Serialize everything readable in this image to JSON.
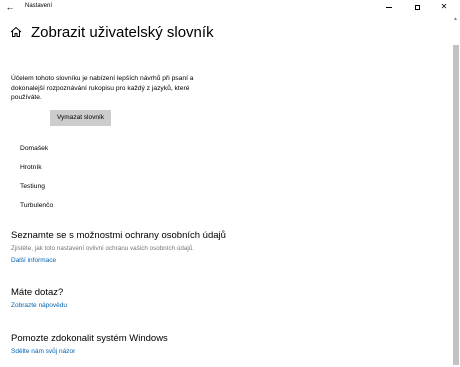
{
  "window": {
    "title": "Nastavení",
    "back_icon": "back-arrow-icon",
    "minimize_icon": "minimize-icon",
    "maximize_icon": "maximize-icon",
    "close_icon": "close-icon"
  },
  "header": {
    "home_icon": "home-icon",
    "title": "Zobrazit uživatelský slovník"
  },
  "dictionary": {
    "description": "Účelem tohoto slovníku je nabízení lepších návrhů při psaní a dokonalejší rozpoznávání rukopisu pro každý z jazyků, které používáte.",
    "clear_button": "Vymazat slovník",
    "words": [
      "Domašek",
      "Hrotník",
      "Testiung",
      "Turbulenčo"
    ]
  },
  "privacy": {
    "heading": "Seznamte se s možnostmi ochrany osobních údajů",
    "subtext": "Zjistěte, jak toto nastavení ovlivní ochranu vašich osobních údajů.",
    "link": "Další informace"
  },
  "help": {
    "heading": "Máte dotaz?",
    "link": "Zobrazte nápovědu"
  },
  "feedback": {
    "heading": "Pomozte zdokonalit systém Windows",
    "link": "Sdělte nám svůj názor"
  },
  "colors": {
    "link": "#0063b1",
    "button_bg": "#cccccc",
    "subtext": "#767676",
    "scrollbar_thumb": "#c2c2c2"
  }
}
